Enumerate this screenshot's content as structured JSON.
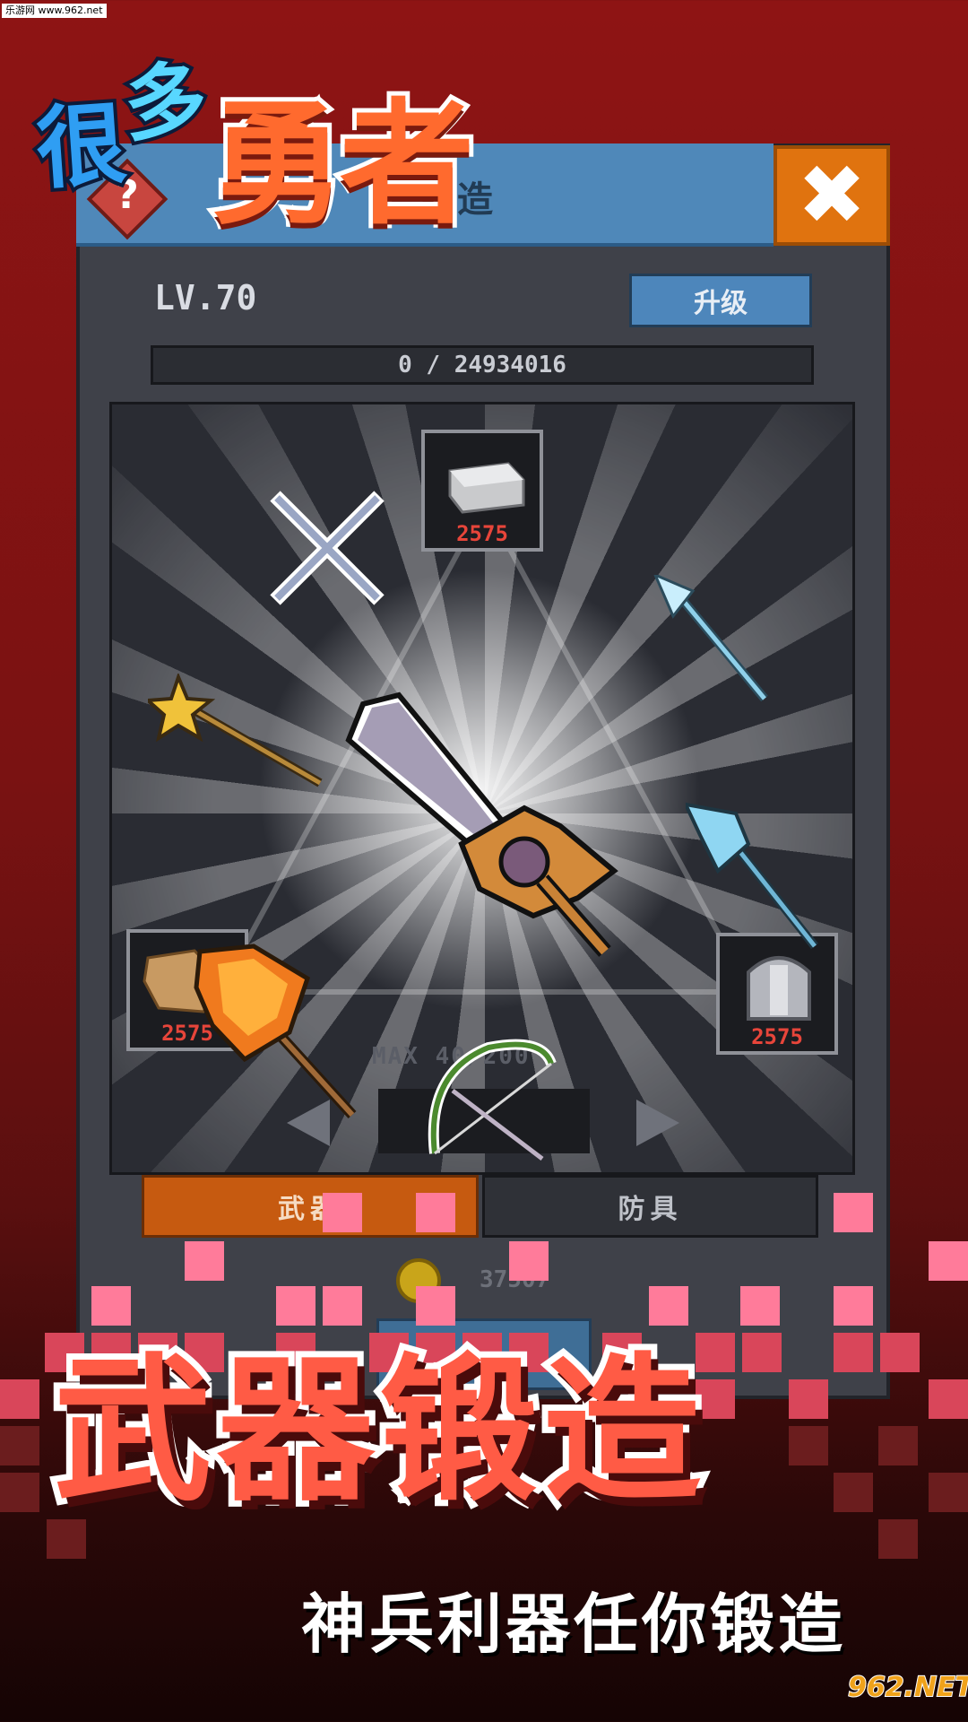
{
  "watermark": {
    "text": "乐游网 www.962.net"
  },
  "logo": {
    "char1": "很",
    "char2": "多",
    "hero": "勇者"
  },
  "window": {
    "title": "锻造",
    "close_glyph": "✖",
    "help_glyph": "?"
  },
  "level": {
    "label": "LV.70"
  },
  "upgrade_button": {
    "label": "升级"
  },
  "progress": {
    "text": "0 / 24934016",
    "current": 0,
    "max": 24934016
  },
  "materials": {
    "top": {
      "count": "2575",
      "icon": "metal-ingot-icon"
    },
    "left": {
      "count": "2575",
      "icon": "leather-icon"
    },
    "right": {
      "count": "2575",
      "icon": "armor-plate-icon"
    }
  },
  "forge": {
    "max_text": "MAX 40/200"
  },
  "weapons": [
    "crossed-daggers-icon",
    "frost-spear-icon",
    "star-wand-icon",
    "great-sword-icon",
    "ice-halberd-icon",
    "fire-axe-icon",
    "vine-bow-icon"
  ],
  "tabs": {
    "weapon": "武器",
    "armor": "防具",
    "selected": "weapon"
  },
  "coins": {
    "value": "37507",
    "icon": "coin-icon"
  },
  "headline": "武器锻造",
  "subline": "神兵利器任你锻造",
  "site_logo": "962.NET",
  "colors": {
    "accent_orange": "#e0730f",
    "accent_blue": "#4f88b9",
    "headline_red": "#ff5b45",
    "count_red": "#e7453a"
  }
}
